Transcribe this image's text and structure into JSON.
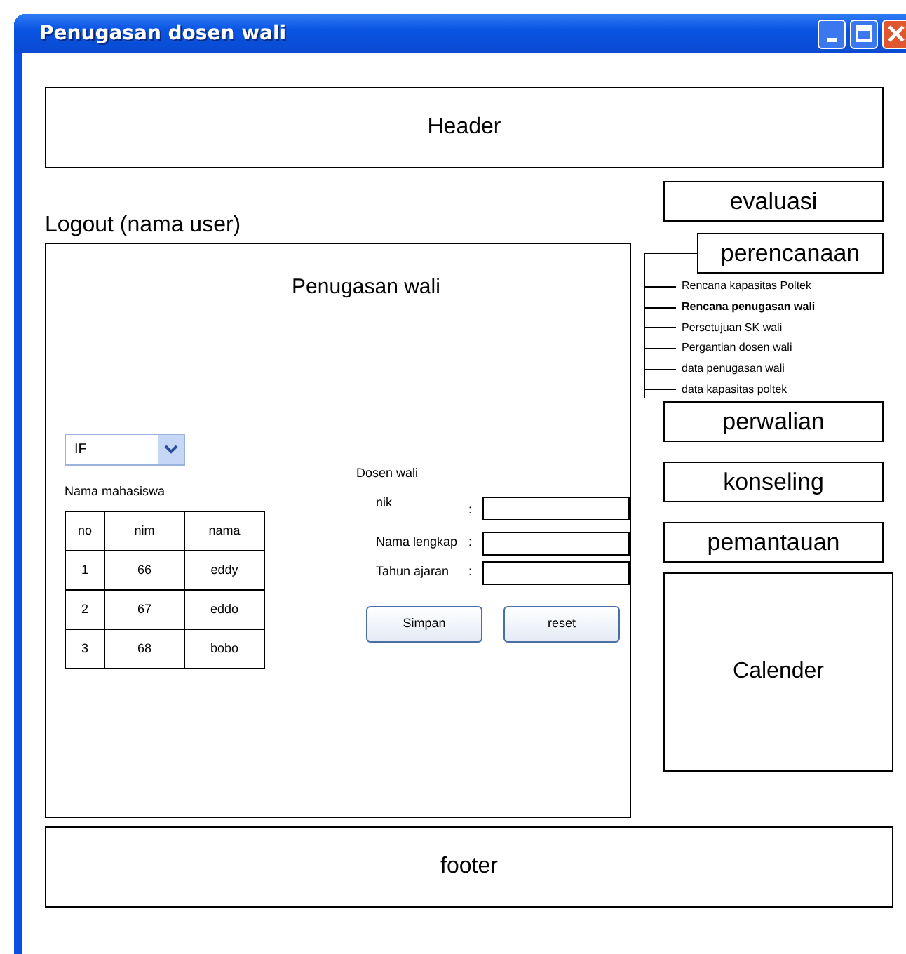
{
  "window": {
    "title": "Penugasan dosen wali"
  },
  "header": "Header",
  "logout": "Logout (nama user)",
  "main": {
    "title": "Penugasan wali",
    "program_select": {
      "value": "IF"
    },
    "students": {
      "label": "Nama mahasiswa",
      "columns": [
        "no",
        "nim",
        "nama"
      ],
      "rows": [
        [
          "1",
          "66",
          "eddy"
        ],
        [
          "2",
          "67",
          "eddo"
        ],
        [
          "3",
          "68",
          "bobo"
        ]
      ]
    },
    "form": {
      "title": "Dosen wali",
      "fields": [
        {
          "label": "nik",
          "sep": ":"
        },
        {
          "label": "Nama lengkap",
          "sep": ":"
        },
        {
          "label": "Tahun ajaran",
          "sep": ":"
        }
      ],
      "buttons": [
        "Simpan",
        "reset"
      ]
    }
  },
  "menu": [
    {
      "label": "evaluasi",
      "expanded": false
    },
    {
      "label": "perencanaan",
      "expanded": true,
      "children": [
        {
          "label": "Rencana kapasitas Poltek",
          "selected": false
        },
        {
          "label": "Rencana penugasan wali",
          "selected": true
        },
        {
          "label": "Persetujuan SK wali",
          "selected": false
        },
        {
          "label": "Pergantian dosen wali",
          "selected": false
        },
        {
          "label": "data penugasan wali",
          "selected": false
        },
        {
          "label": "data kapasitas poltek",
          "selected": false
        }
      ]
    },
    {
      "label": "perwalian",
      "expanded": false
    },
    {
      "label": "konseling",
      "expanded": false
    },
    {
      "label": "pemantauan",
      "expanded": false
    }
  ],
  "calendar": "Calender",
  "footer": "footer"
}
